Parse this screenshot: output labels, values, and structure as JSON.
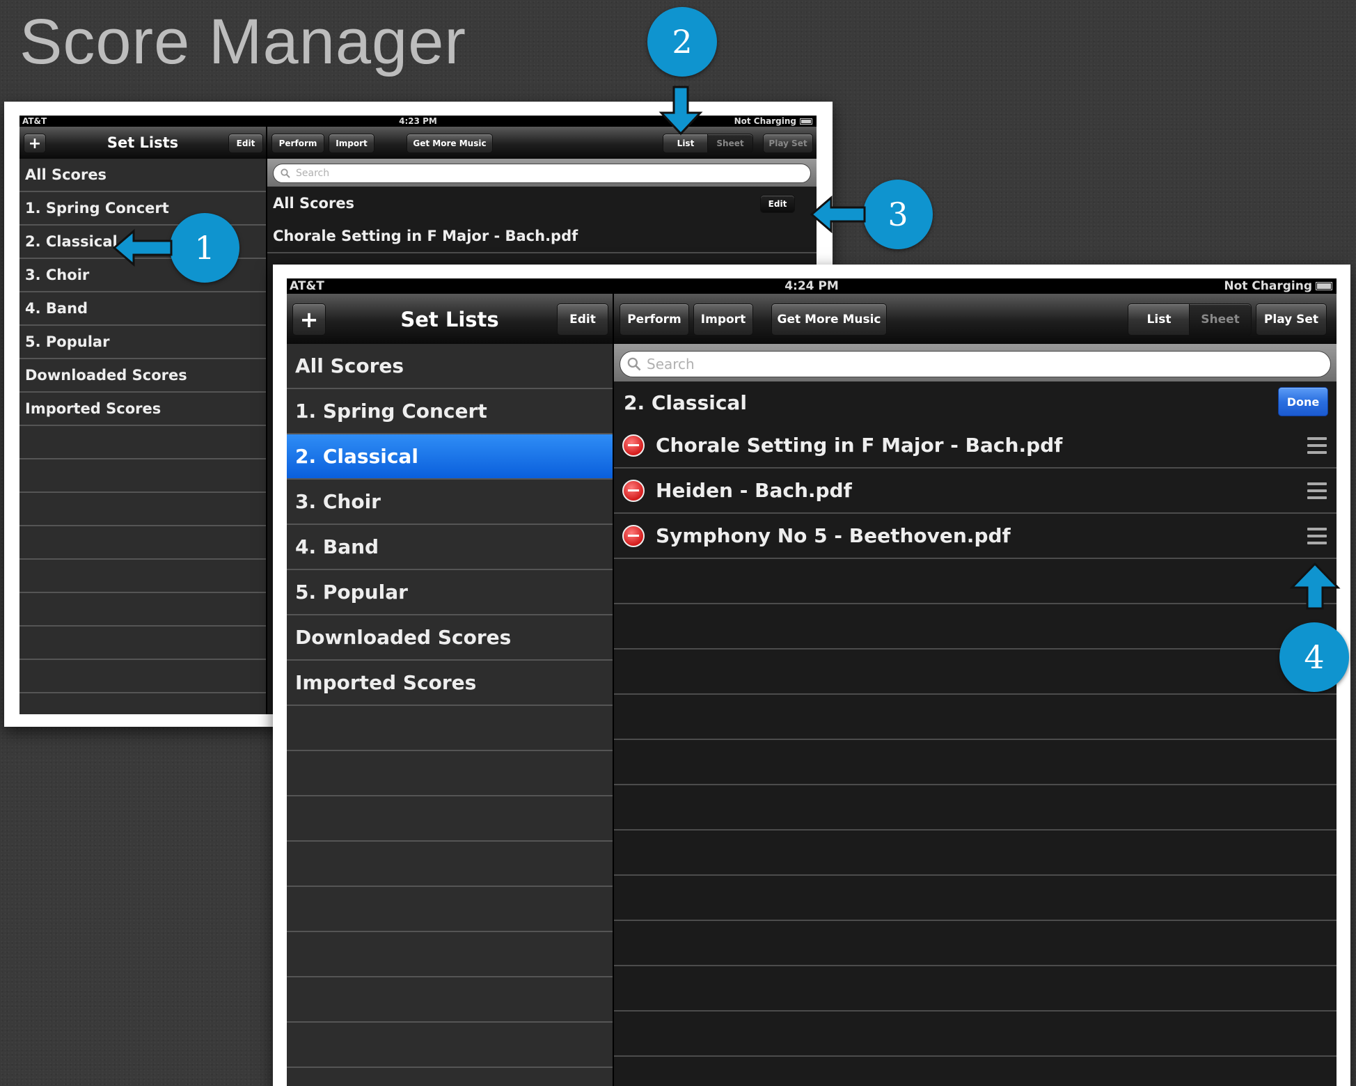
{
  "slide": {
    "title": "Score Manager"
  },
  "back_screen": {
    "status": {
      "carrier": "AT&T",
      "time": "4:23 PM",
      "charging": "Not Charging"
    },
    "sidebar": {
      "add_label": "+",
      "title": "Set Lists",
      "edit_label": "Edit",
      "items": [
        "All Scores",
        "1. Spring Concert",
        "2. Classical",
        "3. Choir",
        "4. Band",
        "5. Popular",
        "Downloaded Scores",
        "Imported Scores"
      ]
    },
    "toolbar": {
      "perform": "Perform",
      "import": "Import",
      "get_more": "Get More Music",
      "list": "List",
      "sheet": "Sheet",
      "play_set": "Play Set"
    },
    "search_placeholder": "Search",
    "section_title": "All Scores",
    "section_edit": "Edit",
    "scores": [
      "Chorale Setting in F Major - Bach.pdf"
    ]
  },
  "front_screen": {
    "status": {
      "carrier": "AT&T",
      "time": "4:24 PM",
      "charging": "Not Charging"
    },
    "sidebar": {
      "add_label": "+",
      "title": "Set Lists",
      "edit_label": "Edit",
      "items": [
        "All Scores",
        "1. Spring Concert",
        "2. Classical",
        "3. Choir",
        "4. Band",
        "5. Popular",
        "Downloaded Scores",
        "Imported Scores"
      ],
      "selected_index": 2
    },
    "toolbar": {
      "perform": "Perform",
      "import": "Import",
      "get_more": "Get More Music",
      "list": "List",
      "sheet": "Sheet",
      "play_set": "Play Set"
    },
    "search_placeholder": "Search",
    "section_title": "2. Classical",
    "section_done": "Done",
    "scores": [
      "Chorale Setting in F Major - Bach.pdf",
      "Heiden - Bach.pdf",
      "Symphony No 5 - Beethoven.pdf"
    ]
  },
  "callouts": {
    "c1": "1",
    "c2": "2",
    "c3": "3",
    "c4": "4"
  },
  "colors": {
    "callout": "#0f94cf",
    "selected": "#0a5fdc",
    "delete": "#d41c1c"
  }
}
